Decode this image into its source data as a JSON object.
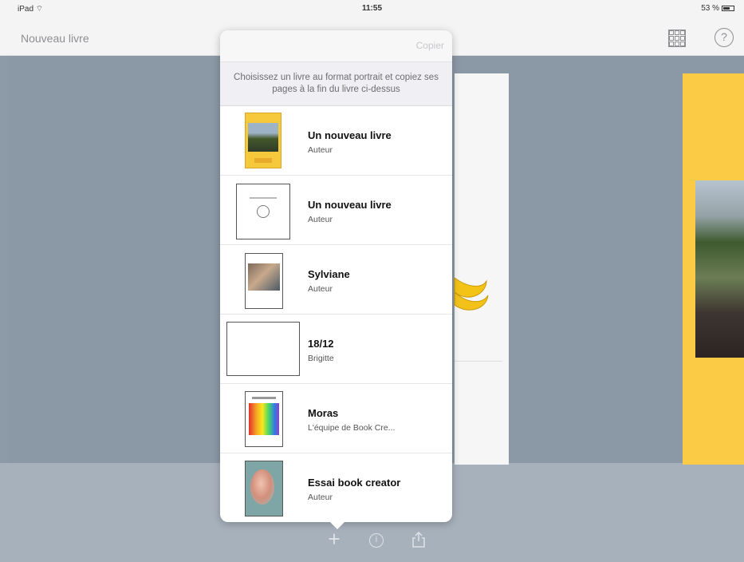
{
  "status_bar": {
    "device": "iPad",
    "time": "11:55",
    "battery": "53 %"
  },
  "nav": {
    "title": "Nouveau livre"
  },
  "popover": {
    "copy_label": "Copier",
    "info": "Choisissez un livre au format portrait et copiez ses pages à la fin du livre ci-dessus",
    "books": [
      {
        "title": "Un nouveau livre",
        "author": "Auteur"
      },
      {
        "title": "Un nouveau livre",
        "author": "Auteur"
      },
      {
        "title": "Sylviane",
        "author": "Auteur"
      },
      {
        "title": "18/12",
        "author": "Brigitte"
      },
      {
        "title": "Moras",
        "author": "L'équipe de Book Cre..."
      },
      {
        "title": "Essai book creator",
        "author": "Auteur"
      }
    ]
  },
  "toolbar": {
    "plus": "+",
    "info": "i"
  },
  "colors": {
    "canvas": "#8b98a6",
    "page_yellow": "#fbcb45",
    "bar": "#f4f4f5"
  }
}
